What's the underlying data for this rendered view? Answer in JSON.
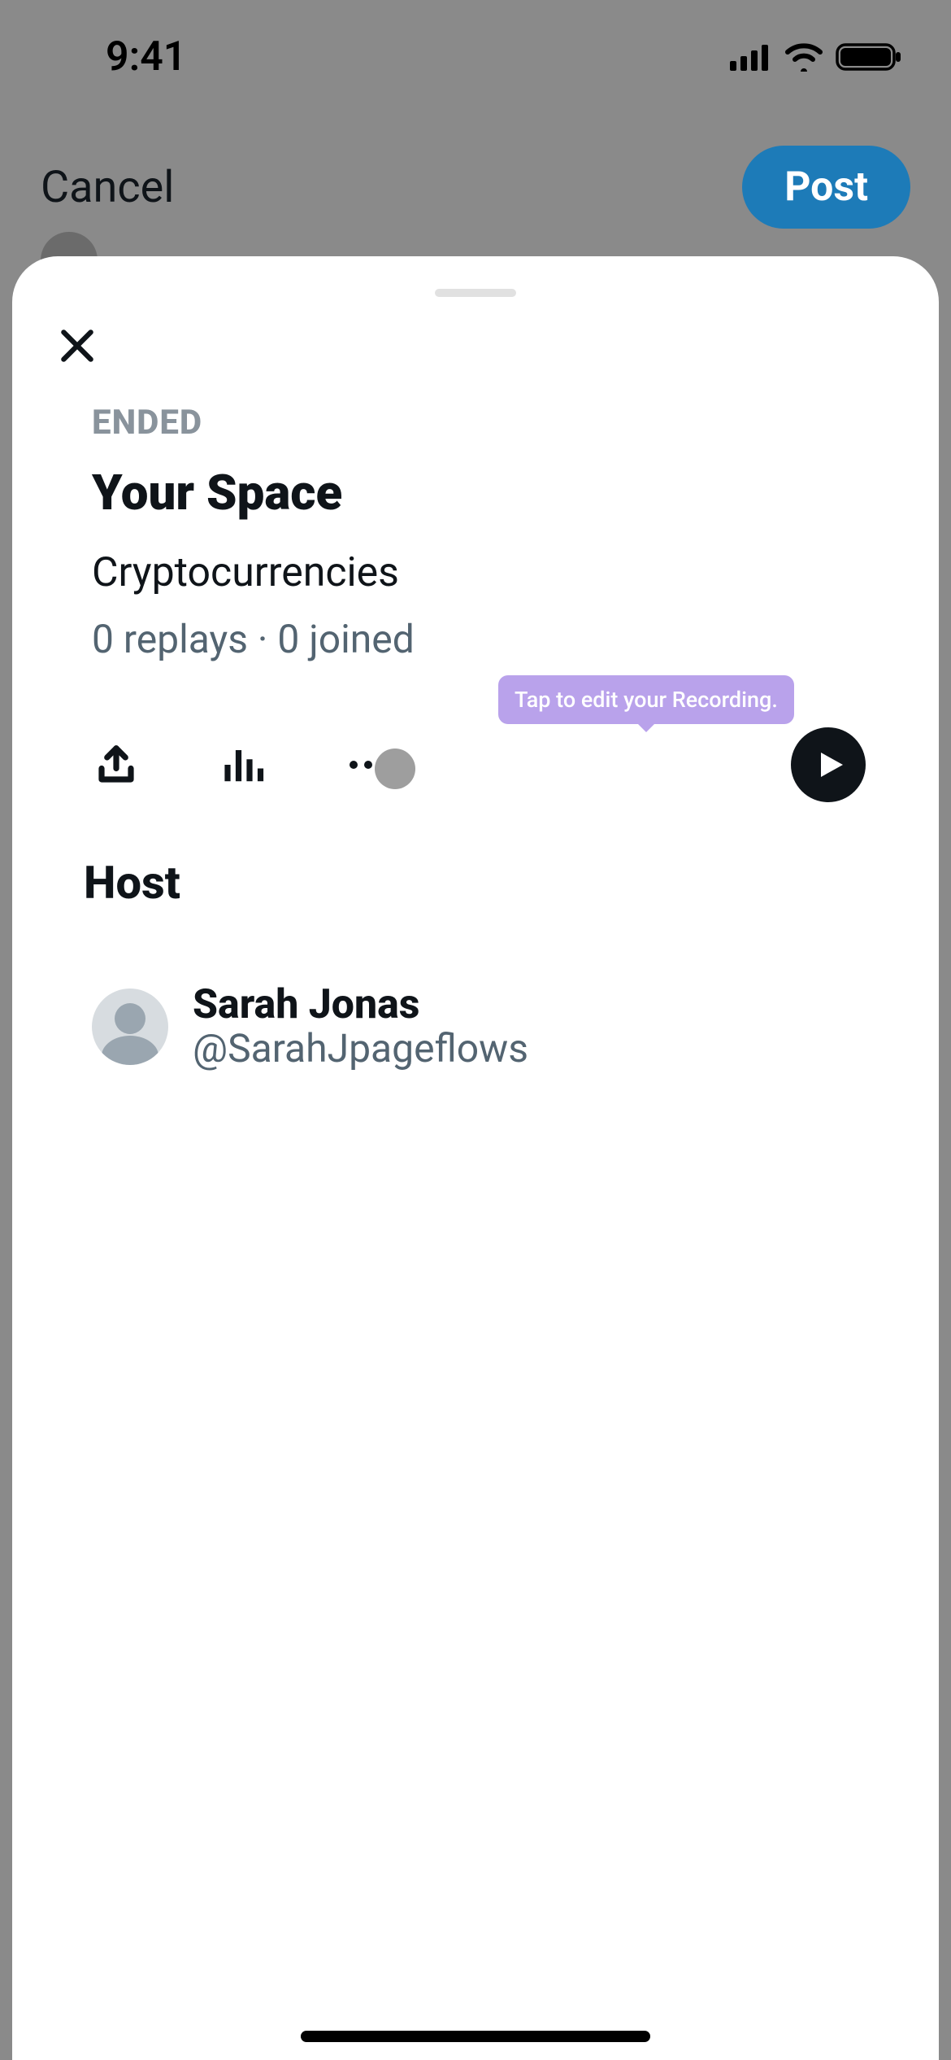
{
  "statusBar": {
    "time": "9:41"
  },
  "compose": {
    "cancel": "Cancel",
    "post": "Post"
  },
  "sheet": {
    "status": "ENDED",
    "title": "Your Space",
    "topic": "Cryptocurrencies",
    "stats": "0 replays · 0 joined",
    "tooltip": "Tap to edit your Recording.",
    "hostHeading": "Host",
    "host": {
      "name": "Sarah Jonas",
      "handle": "@SarahJpageflows"
    }
  }
}
